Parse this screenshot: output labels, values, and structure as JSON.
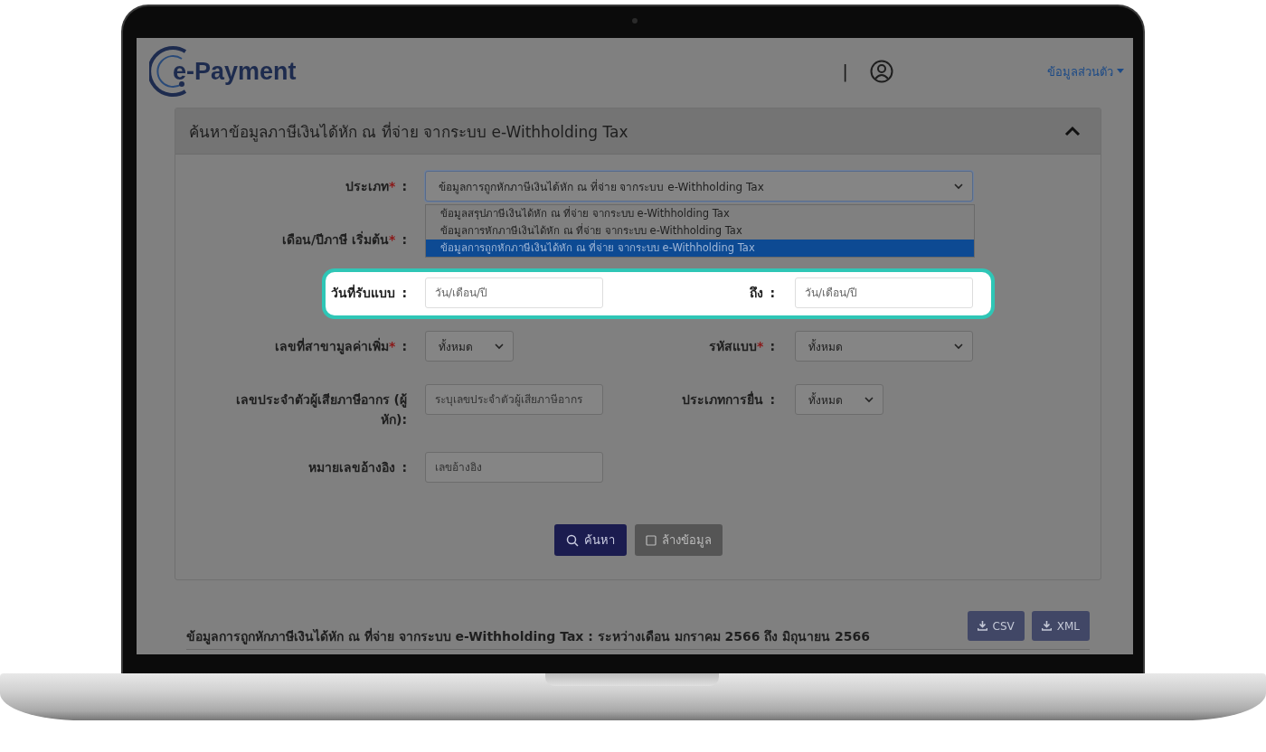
{
  "header": {
    "logo": "e-Payment",
    "separator": "|",
    "user_menu": "ข้อมูลส่วนตัว"
  },
  "panel": {
    "title": "ค้นหาข้อมูลภาษีเงินได้หัก ณ ที่จ่าย จากระบบ e-Withholding Tax",
    "expanded": true
  },
  "form_rows": [
    {
      "highlighted": false,
      "fields": [
        {
          "label": "ประเภท",
          "required_mark": "*",
          "suffix": ":",
          "kind": "select",
          "value": "ข้อมูลการถูกหักภาษีเงินได้หัก ณ ที่จ่าย จากระบบ e-Withholding Tax",
          "open": true,
          "options": [
            {
              "label": "ข้อมูลสรุปภาษีเงินได้หัก ณ ที่จ่าย จากระบบ e-Withholding Tax",
              "selected": false
            },
            {
              "label": "ข้อมูลการหักภาษีเงินได้หัก ณ ที่จ่าย จากระบบ e-Withholding Tax",
              "selected": false
            },
            {
              "label": "ข้อมูลการถูกหักภาษีเงินได้หัก ณ ที่จ่าย จากระบบ e-Withholding Tax",
              "selected": true
            }
          ]
        }
      ]
    },
    {
      "highlighted": false,
      "fields": [
        {
          "label": "เดือน/ปีภาษี เริ่มต้น",
          "required_mark": "*",
          "suffix": ":",
          "kind": "hidden"
        }
      ]
    },
    {
      "highlighted": true,
      "fields": [
        {
          "label": "วันที่รับแบบ",
          "suffix": ":",
          "kind": "date",
          "placeholder": "วัน/เดือน/ปี"
        },
        {
          "label": "ถึง",
          "suffix": ":",
          "kind": "date",
          "placeholder": "วัน/เดือน/ปี"
        }
      ]
    },
    {
      "highlighted": false,
      "fields": [
        {
          "label": "เลขที่สาขามูลค่าเพิ่ม",
          "required_mark": "*",
          "suffix": ":",
          "kind": "select",
          "value": "ทั้งหมด"
        },
        {
          "label": "รหัสแบบ",
          "required_mark": "*",
          "suffix": ":",
          "kind": "select",
          "value": "ทั้งหมด"
        }
      ]
    },
    {
      "highlighted": false,
      "fields": [
        {
          "label": "เลขประจำตัวผู้เสียภาษีอากร (ผู้หัก):",
          "kind": "text",
          "placeholder": "ระบุเลขประจำตัวผู้เสียภาษีอากร"
        },
        {
          "label": "ประเภทการยื่น",
          "suffix": ":",
          "kind": "select",
          "value": "ทั้งหมด"
        }
      ]
    },
    {
      "highlighted": false,
      "fields": [
        {
          "label": "หมายเลขอ้างอิง",
          "suffix": ":",
          "kind": "text",
          "placeholder": "เลขอ้างอิง"
        }
      ]
    }
  ],
  "buttons": [
    {
      "label": "ค้นหา",
      "kind": "search"
    },
    {
      "label": "ล้างข้อมูล",
      "kind": "clear"
    }
  ],
  "results": {
    "title": "ข้อมูลการถูกหักภาษีเงินได้หัก ณ ที่จ่าย จากระบบ e-Withholding Tax : ระหว่างเดือน มกราคม 2566 ถึง มิถุนายน 2566",
    "exports": [
      "CSV",
      "XML"
    ]
  }
}
